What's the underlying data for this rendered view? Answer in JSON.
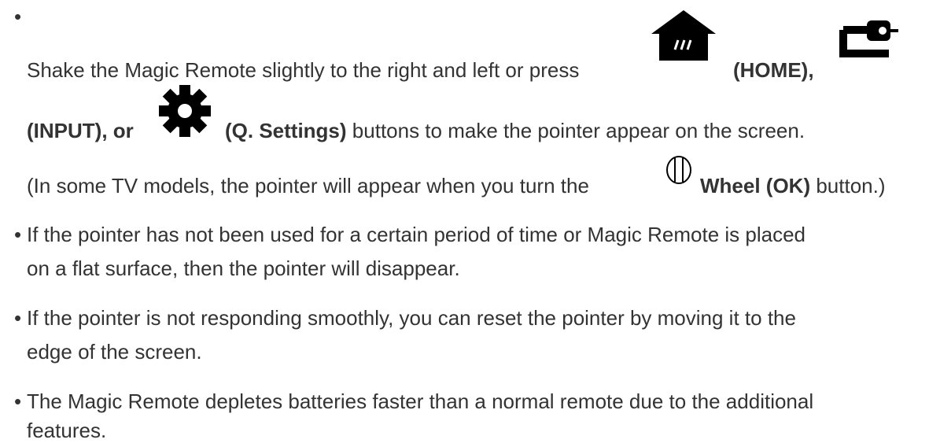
{
  "bullet_char": "•",
  "first_item": {
    "line1_text": "Shake the Magic Remote slightly to the right and left or press",
    "home_label": "(HOME),",
    "input_label": "(INPUT), or",
    "qsettings_label": "(Q. Settings)",
    "line2_rest": "buttons to make the pointer appear on the screen.",
    "note_before": "(In some TV models, the pointer will appear when you turn the",
    "wheel_label": "Wheel (OK)",
    "note_after": "button.)",
    "icons": [
      "home-icon",
      "input-icon",
      "settings-gear-icon",
      "wheel-icon"
    ]
  },
  "items": [
    {
      "line1": "If the pointer has not been used for a certain period of time or Magic Remote is placed",
      "line2": "on a flat surface, then the pointer will disappear."
    },
    {
      "line1": "If the pointer is not responding smoothly, you can reset the pointer by moving it to the",
      "line2": "edge of the screen."
    },
    {
      "line1": "The Magic Remote depletes batteries faster than a normal remote due to the additional",
      "line2": "features."
    }
  ]
}
